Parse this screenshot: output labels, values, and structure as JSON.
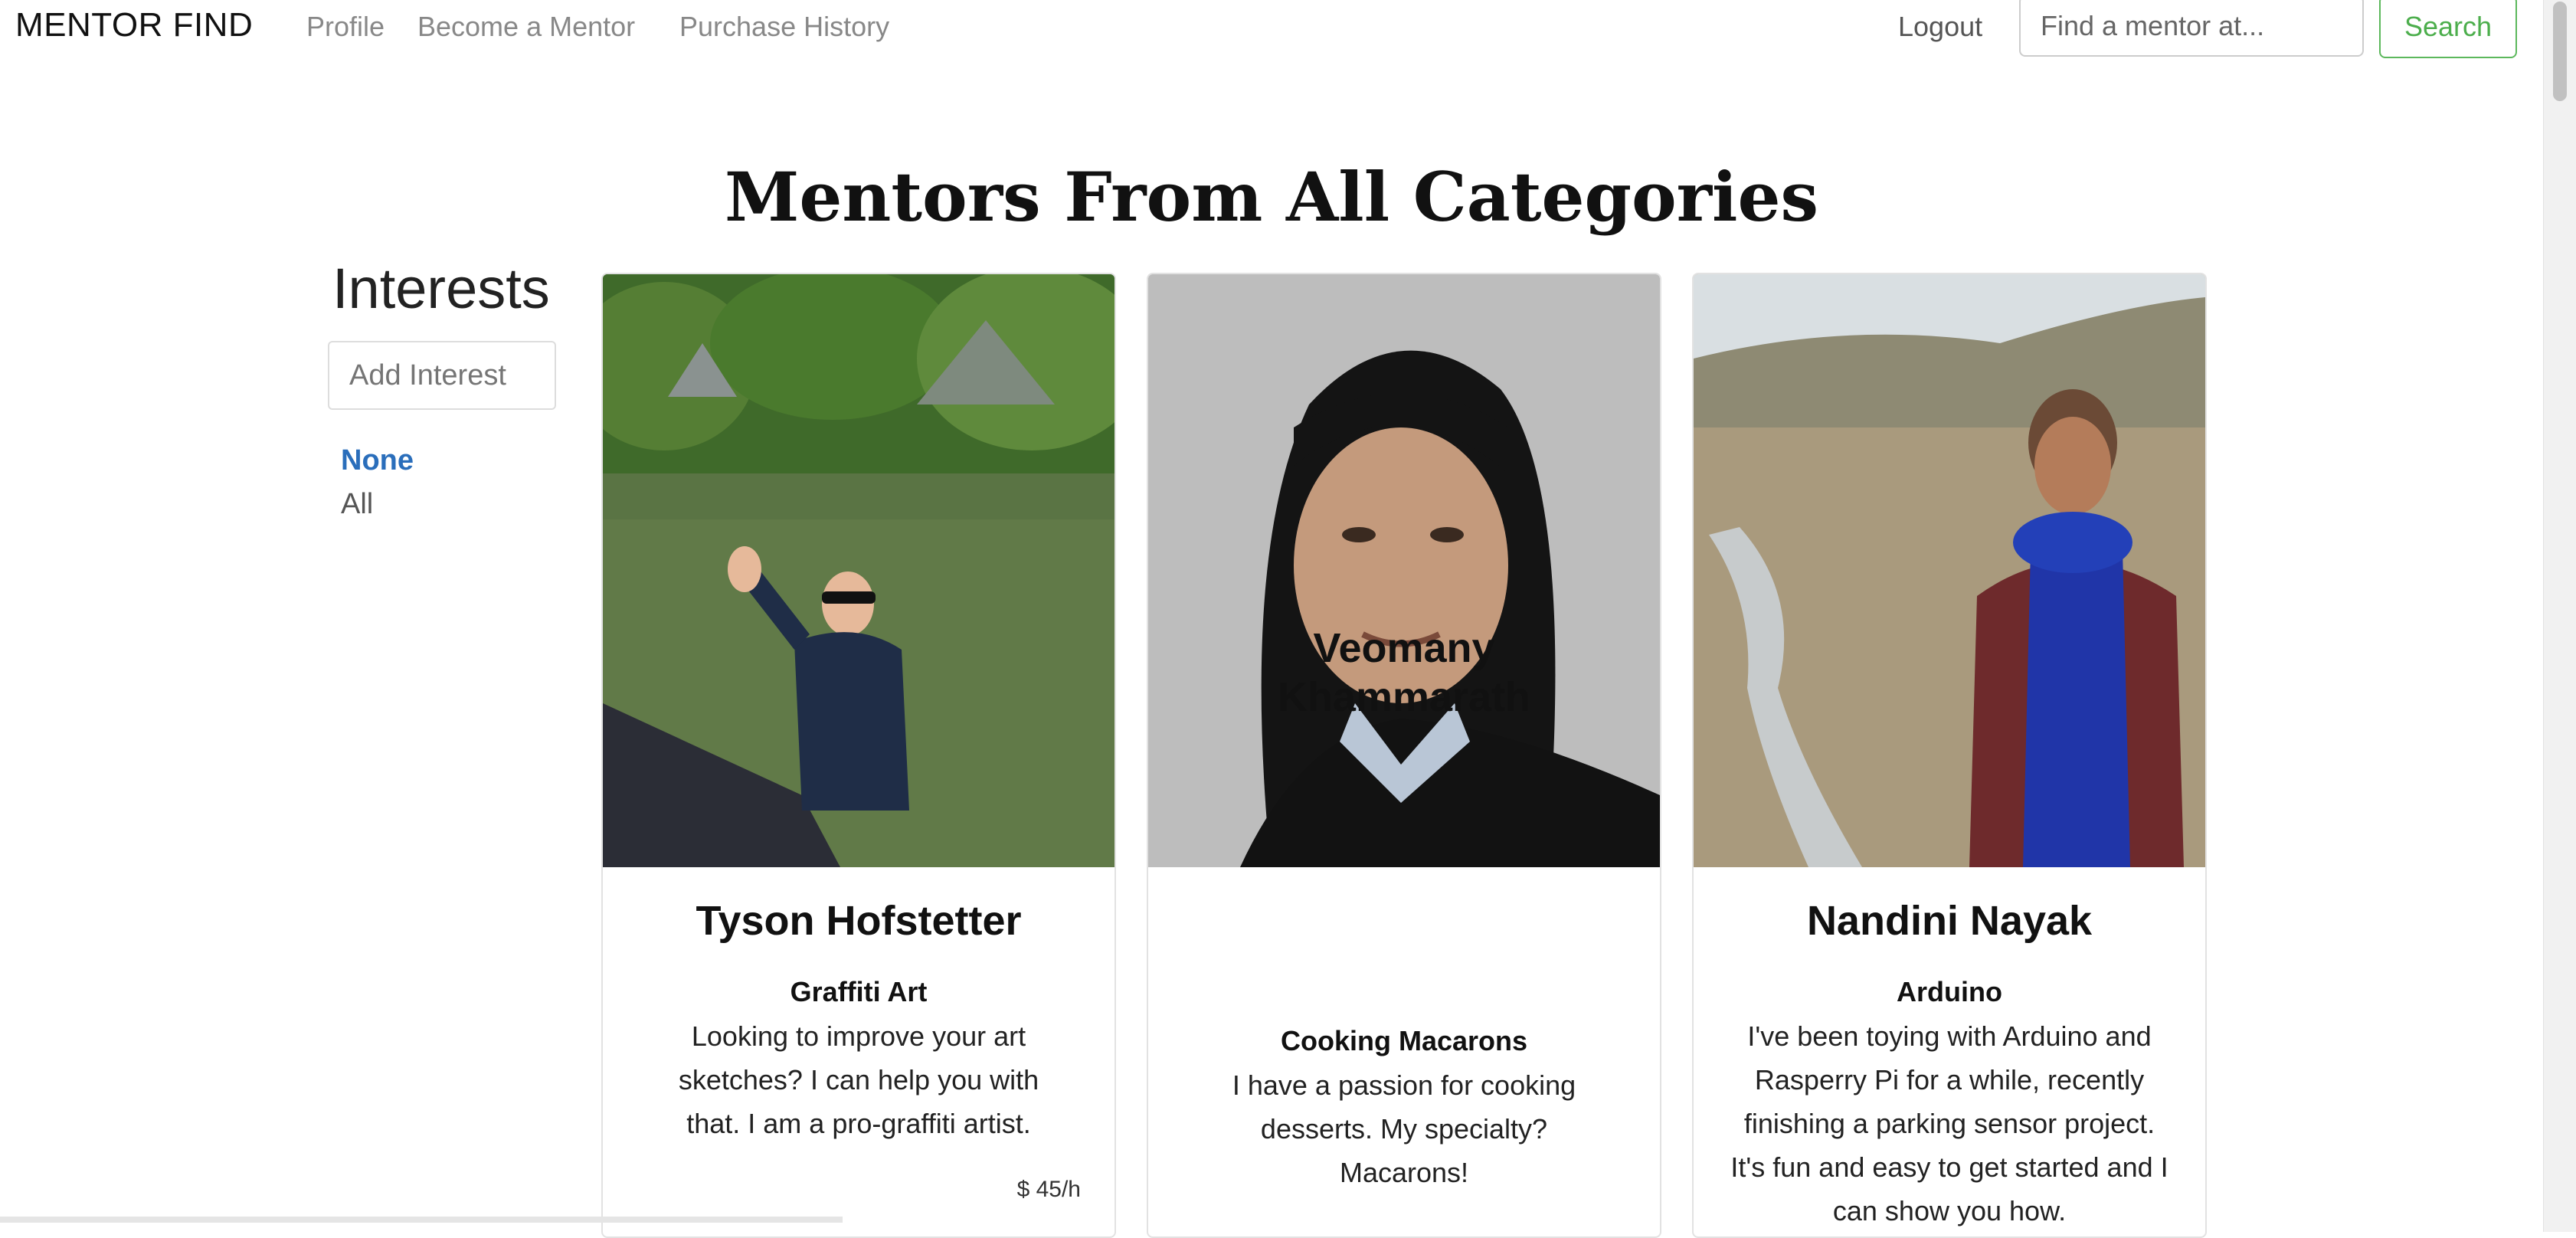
{
  "navbar": {
    "brand": "MENTOR FIND",
    "links": [
      "Profile",
      "Become a Mentor",
      "Purchase History"
    ],
    "logout": "Logout",
    "search_placeholder": "Find a mentor at...",
    "search_button": "Search"
  },
  "main": {
    "title": "Mentors From All Categories"
  },
  "sidebar": {
    "title": "Interests",
    "add_placeholder": "Add Interest",
    "items": [
      "None",
      "All"
    ]
  },
  "mentors": [
    {
      "name": "Tyson Hofstetter",
      "skill": "Graffiti Art",
      "description": "Looking to improve your art sketches? I can help you with that. I am a pro-graffiti artist.",
      "price": "$ 45/h"
    },
    {
      "name": "Veomany Khammarath",
      "skill": "Cooking Macarons",
      "description": "I have a passion for cooking desserts. My specialty? Macarons!"
    },
    {
      "name": "Nandini Nayak",
      "skill": "Arduino",
      "description": "I've been toying with Arduino and Rasperry Pi for a while, recently finishing a parking sensor project. It's fun and easy to get started and I can show you how."
    }
  ],
  "colors": {
    "link_active": "#2a6ebb",
    "search_green": "#4cae4c"
  }
}
